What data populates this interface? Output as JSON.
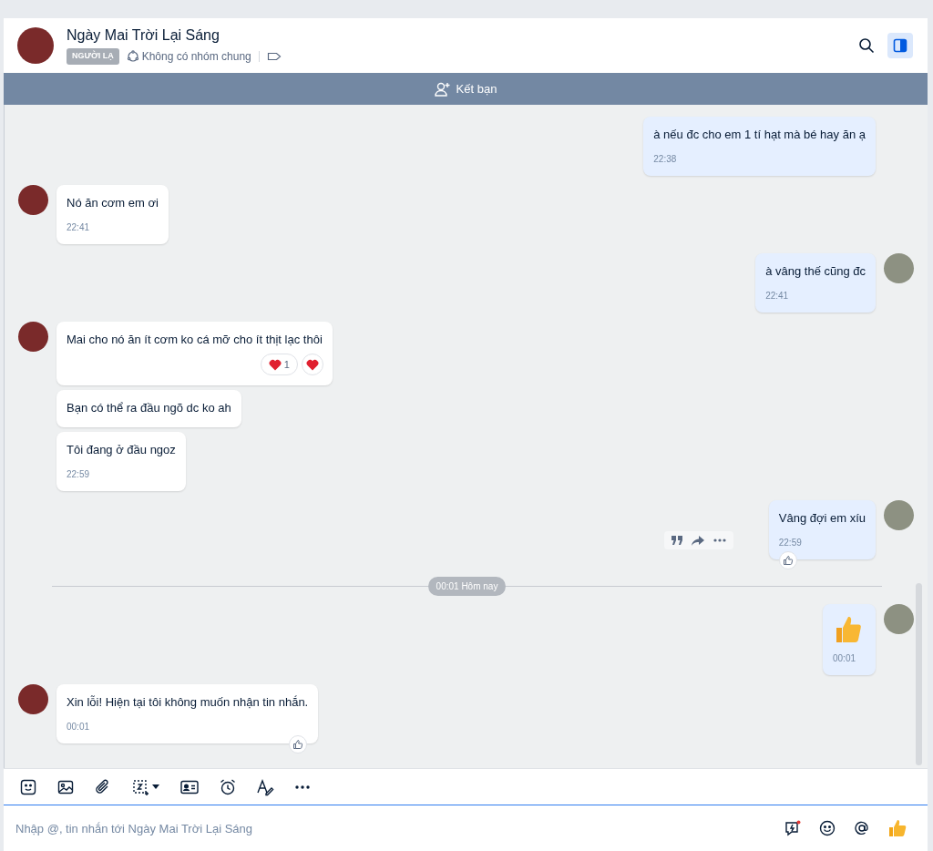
{
  "header": {
    "name": "Ngày Mai Trời Lại Sáng",
    "badge": "NGƯỜI LẠ",
    "groups": "Không có nhóm chung"
  },
  "banner": {
    "label": "Kết bạn"
  },
  "messages": [
    {
      "kind": "out",
      "avatar": false,
      "text": "à nếu đc cho em 1 tí hạt mà bé hay ăn ạ",
      "time": "22:38"
    },
    {
      "kind": "in",
      "avatar": true,
      "text": "Nó ăn cơm em ơi",
      "time": "22:41"
    },
    {
      "kind": "out",
      "avatar": true,
      "text": "à vâng thế cũng đc",
      "time": "22:41"
    },
    {
      "kind": "in",
      "avatar": true,
      "text": "Mai cho nó ăn ít cơm ko cá mỡ cho ít thịt lạc thôi",
      "reaction_count": "1",
      "heart_button": true
    },
    {
      "kind": "in",
      "avatar": false,
      "text": "Bạn có thể ra đầu ngõ dc ko ah"
    },
    {
      "kind": "in",
      "avatar": false,
      "text": "Tôi đang ở đầu ngoz",
      "time": "22:59"
    },
    {
      "kind": "out",
      "avatar": true,
      "text": "Vâng đợi em xíu",
      "time": "22:59",
      "like_button": true,
      "actions_shown": true
    },
    {
      "kind": "divider",
      "text": "00:01 Hôm nay"
    },
    {
      "kind": "out",
      "avatar": true,
      "sticker": true,
      "time": "00:01"
    },
    {
      "kind": "in",
      "avatar": true,
      "text": "Xin lỗi! Hiện tại tôi không muốn nhận tin nhắn.",
      "time": "00:01",
      "like_button": true
    }
  ],
  "composer": {
    "placeholder": "Nhập @, tin nhắn tới Ngày Mai Trời Lại Sáng"
  }
}
